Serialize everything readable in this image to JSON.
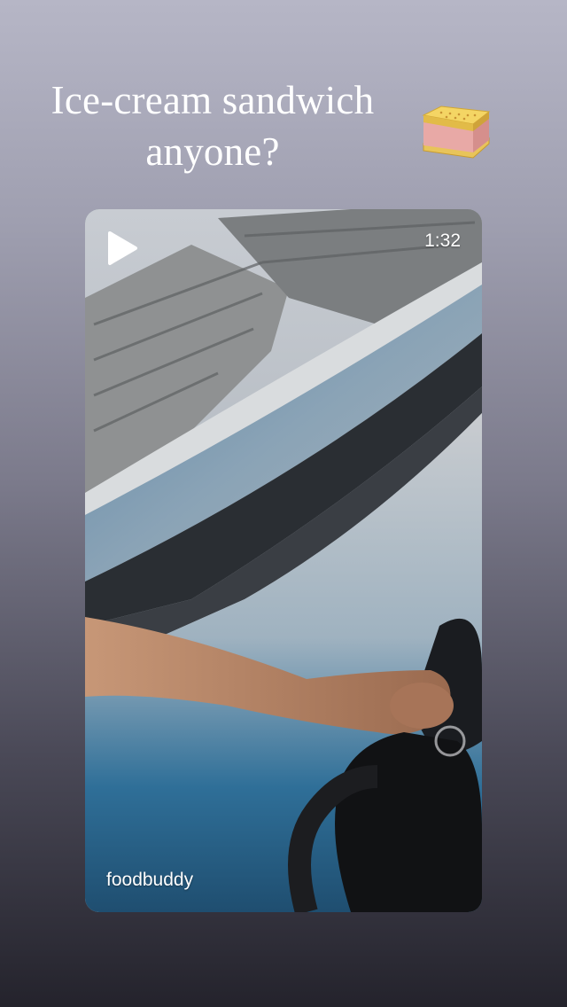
{
  "story": {
    "caption_line1": "Ice-cream sandwich",
    "caption_line2": "anyone?",
    "sticker": "ice-cream-sandwich-icon"
  },
  "video_post": {
    "duration": "1:32",
    "username": "foodbuddy",
    "play_icon": "play-icon"
  },
  "colors": {
    "background_top": "#b6b6c6",
    "background_bottom": "#24232c",
    "text": "#ffffff"
  }
}
